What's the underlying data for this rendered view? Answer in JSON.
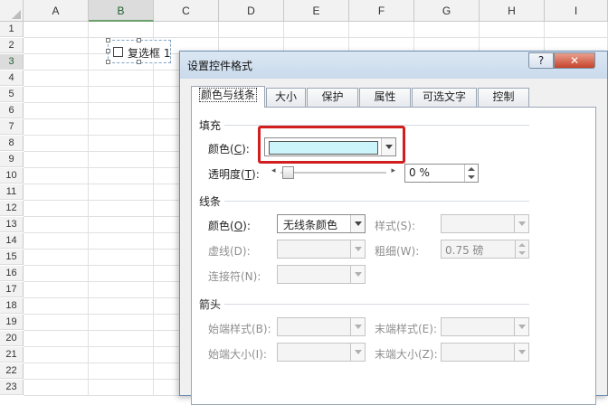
{
  "sheet": {
    "columns": [
      "A",
      "B",
      "C",
      "D",
      "E",
      "F",
      "G",
      "H",
      "I"
    ],
    "selected_column": "B",
    "rows": [
      "1",
      "2",
      "3",
      "4",
      "5",
      "6",
      "7",
      "8",
      "9",
      "10",
      "11",
      "12",
      "13",
      "14",
      "15",
      "16",
      "17",
      "18",
      "19",
      "20",
      "21",
      "22",
      "23"
    ],
    "selected_row": "3",
    "checkbox_control": {
      "label": "复选框 1"
    }
  },
  "dialog": {
    "title": "设置控件格式",
    "help_label": "?",
    "close_label": "✕",
    "tabs": [
      {
        "label": "颜色与线条",
        "active": true
      },
      {
        "label": "大小",
        "active": false
      },
      {
        "label": "保护",
        "active": false
      },
      {
        "label": "属性",
        "active": false
      },
      {
        "label": "可选文字",
        "active": false
      },
      {
        "label": "控制",
        "active": false
      }
    ],
    "fill": {
      "section_title": "填充",
      "color_label": "颜色(",
      "color_key": "C",
      "color_label_end": "):",
      "color_value": "#ccf5fb",
      "transparency_label": "透明度(",
      "transparency_key": "T",
      "transparency_label_end": "):",
      "transparency_value": "0 %",
      "transparency_fraction": 0
    },
    "line": {
      "section_title": "线条",
      "color_label": "颜色(",
      "color_key": "O",
      "color_label_end": "):",
      "color_value": "无线条颜色",
      "style_label": "样式(S):",
      "dash_label": "虚线(D):",
      "weight_label": "粗细(W):",
      "weight_value": "0.75 磅",
      "connector_label": "连接符(N):"
    },
    "arrows": {
      "section_title": "箭头",
      "begin_style_label": "始端样式(B):",
      "end_style_label": "末端样式(E):",
      "begin_size_label": "始端大小(I):",
      "end_size_label": "末端大小(Z):"
    },
    "highlight_color": "#d11f1f"
  }
}
